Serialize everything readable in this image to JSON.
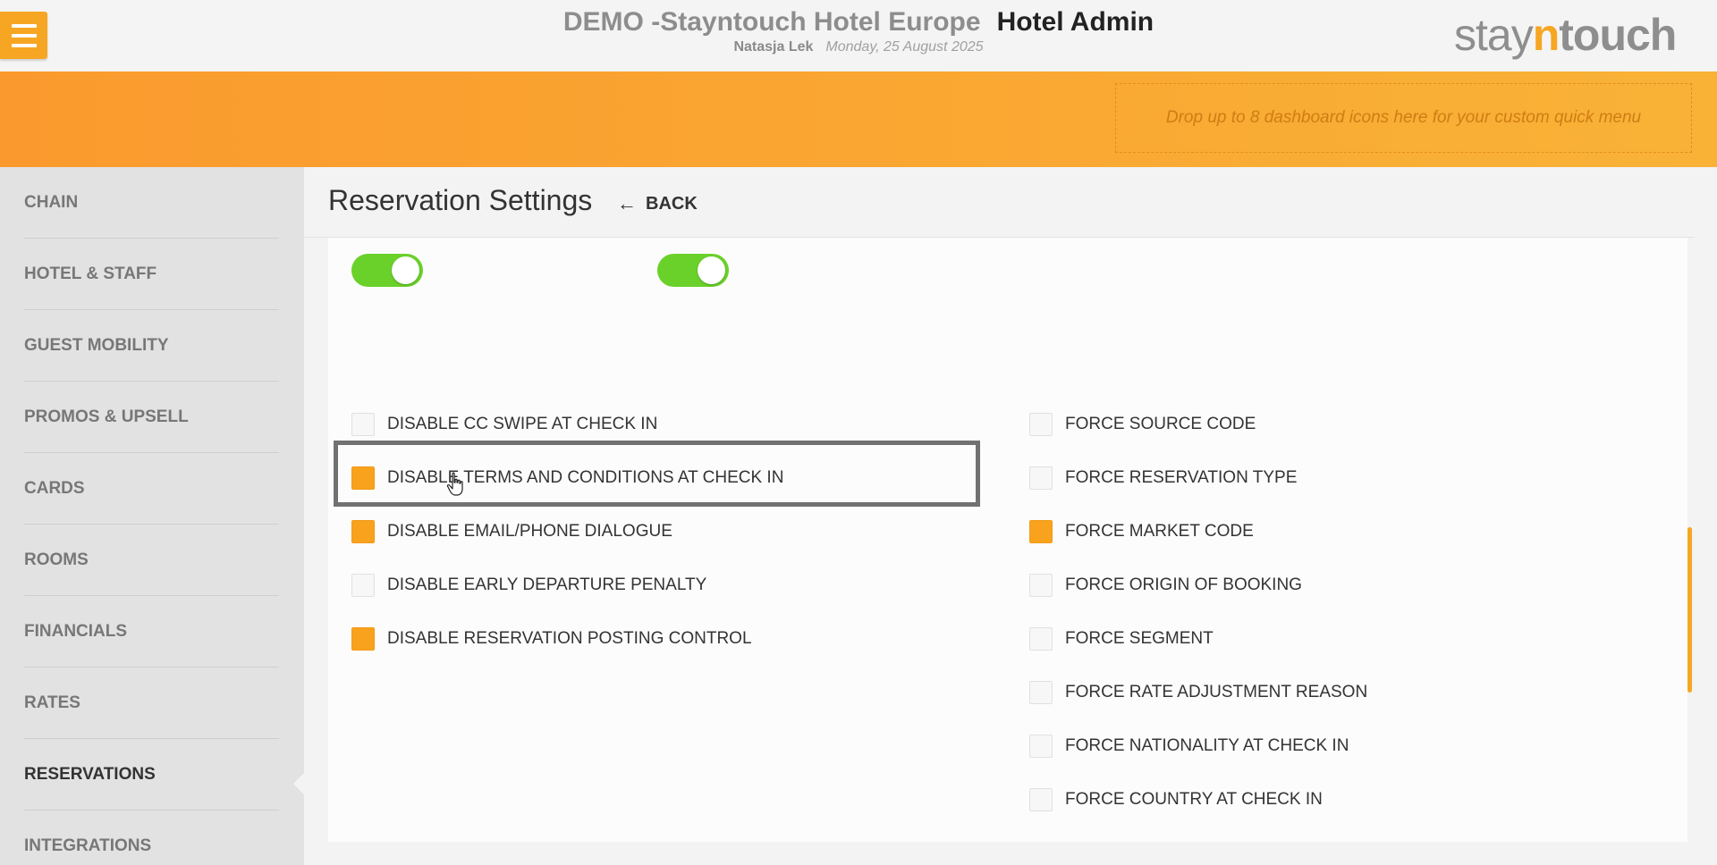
{
  "header": {
    "hotel_name": "DEMO -Stayntouch Hotel Europe",
    "app_title": "Hotel Admin",
    "user_name": "Natasja Lek",
    "date": "Monday, 25 August 2025",
    "logo": {
      "stay": "stay",
      "n": "n",
      "touch": "touch"
    },
    "menu_icon": "hamburger-icon"
  },
  "banner": {
    "dropzone_text": "Drop up to 8 dashboard icons here for your custom quick menu"
  },
  "sidebar": {
    "items": [
      {
        "label": "CHAIN",
        "active": false
      },
      {
        "label": "HOTEL & STAFF",
        "active": false
      },
      {
        "label": "GUEST MOBILITY",
        "active": false
      },
      {
        "label": "PROMOS & UPSELL",
        "active": false
      },
      {
        "label": "CARDS",
        "active": false
      },
      {
        "label": "ROOMS",
        "active": false
      },
      {
        "label": "FINANCIALS",
        "active": false
      },
      {
        "label": "RATES",
        "active": false
      },
      {
        "label": "RESERVATIONS",
        "active": true
      },
      {
        "label": "INTEGRATIONS",
        "active": false
      }
    ]
  },
  "page": {
    "title": "Reservation Settings",
    "back_label": "BACK",
    "back_icon": "arrow-left-icon"
  },
  "toggles": [
    {
      "on": true
    },
    {
      "on": true
    }
  ],
  "left_checkboxes": [
    {
      "label": "DISABLE CC SWIPE AT CHECK IN",
      "checked": false
    },
    {
      "label": "DISABLE TERMS AND CONDITIONS AT CHECK IN",
      "checked": true
    },
    {
      "label": "DISABLE EMAIL/PHONE DIALOGUE",
      "checked": true
    },
    {
      "label": "DISABLE EARLY DEPARTURE PENALTY",
      "checked": false
    },
    {
      "label": "DISABLE RESERVATION POSTING CONTROL",
      "checked": true
    }
  ],
  "right_checkboxes": [
    {
      "label": "FORCE SOURCE CODE",
      "checked": false
    },
    {
      "label": "FORCE RESERVATION TYPE",
      "checked": false
    },
    {
      "label": "FORCE MARKET CODE",
      "checked": true
    },
    {
      "label": "FORCE ORIGIN OF BOOKING",
      "checked": false
    },
    {
      "label": "FORCE SEGMENT",
      "checked": false
    },
    {
      "label": "FORCE RATE ADJUSTMENT REASON",
      "checked": false
    },
    {
      "label": "FORCE NATIONALITY AT CHECK IN",
      "checked": false
    },
    {
      "label": "FORCE COUNTRY AT CHECK IN",
      "checked": false
    }
  ],
  "colors": {
    "accent": "#f6a623",
    "toggle_on": "#6ad12a",
    "checkbox_checked": "#f8a21e"
  }
}
